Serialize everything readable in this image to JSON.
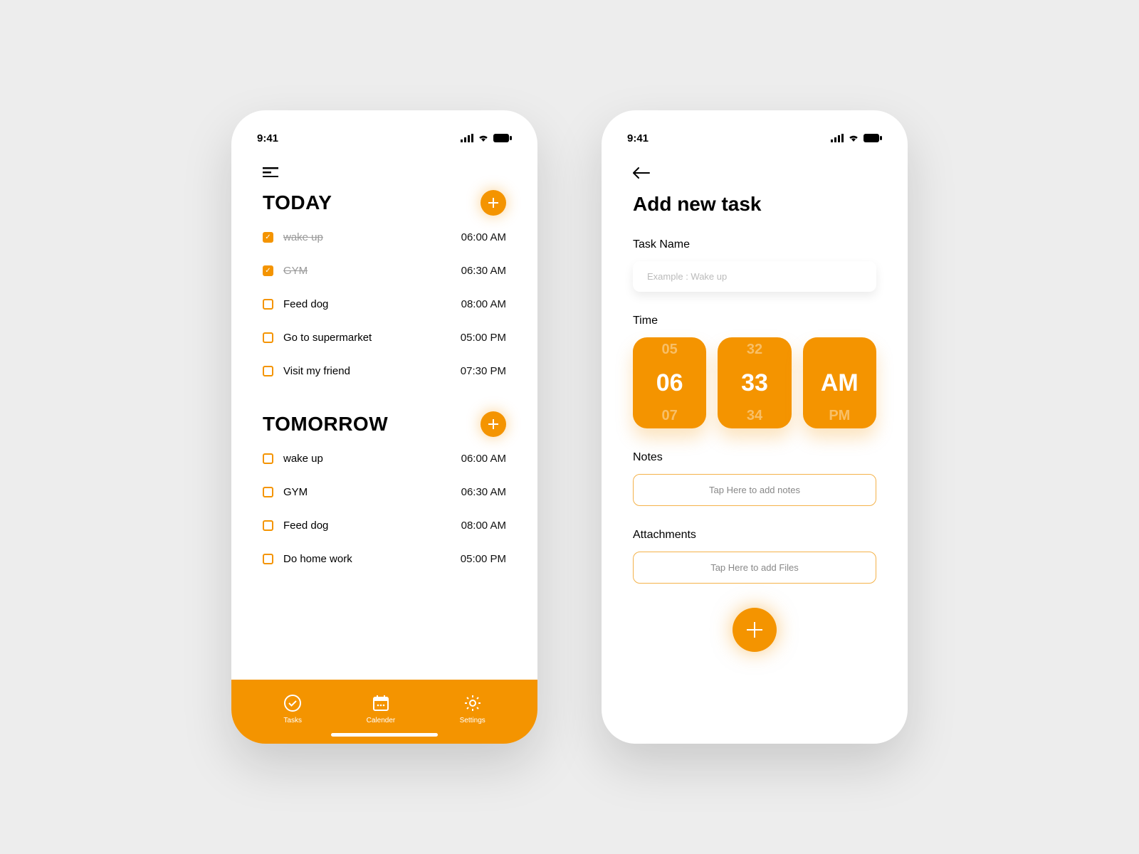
{
  "accent": "#f49400",
  "status": {
    "time": "9:41"
  },
  "screen1": {
    "sections": [
      {
        "title": "TODAY",
        "items": [
          {
            "label": "wake up",
            "time": "06:00 AM",
            "done": true
          },
          {
            "label": "GYM",
            "time": "06:30 AM",
            "done": true
          },
          {
            "label": "Feed dog",
            "time": "08:00 AM",
            "done": false
          },
          {
            "label": "Go to supermarket",
            "time": "05:00 PM",
            "done": false
          },
          {
            "label": "Visit my friend",
            "time": "07:30 PM",
            "done": false
          }
        ]
      },
      {
        "title": "TOMORROW",
        "items": [
          {
            "label": "wake up",
            "time": "06:00 AM",
            "done": false
          },
          {
            "label": "GYM",
            "time": "06:30 AM",
            "done": false
          },
          {
            "label": "Feed dog",
            "time": "08:00 AM",
            "done": false
          },
          {
            "label": "Do home work",
            "time": "05:00 PM",
            "done": false
          }
        ]
      }
    ],
    "nav": {
      "tasks": "Tasks",
      "calendar": "Calender",
      "settings": "Settings"
    }
  },
  "screen2": {
    "title": "Add new task",
    "taskName": {
      "label": "Task Name",
      "placeholder": "Example : Wake up"
    },
    "time": {
      "label": "Time",
      "hour": {
        "prev": "05",
        "cur": "06",
        "next": "07"
      },
      "minute": {
        "prev": "32",
        "cur": "33",
        "next": "34"
      },
      "ampm": {
        "prev": "",
        "cur": "AM",
        "next": "PM"
      }
    },
    "notes": {
      "label": "Notes",
      "placeholder": "Tap Here to add notes"
    },
    "attachments": {
      "label": "Attachments",
      "placeholder": "Tap Here to add Files"
    }
  }
}
